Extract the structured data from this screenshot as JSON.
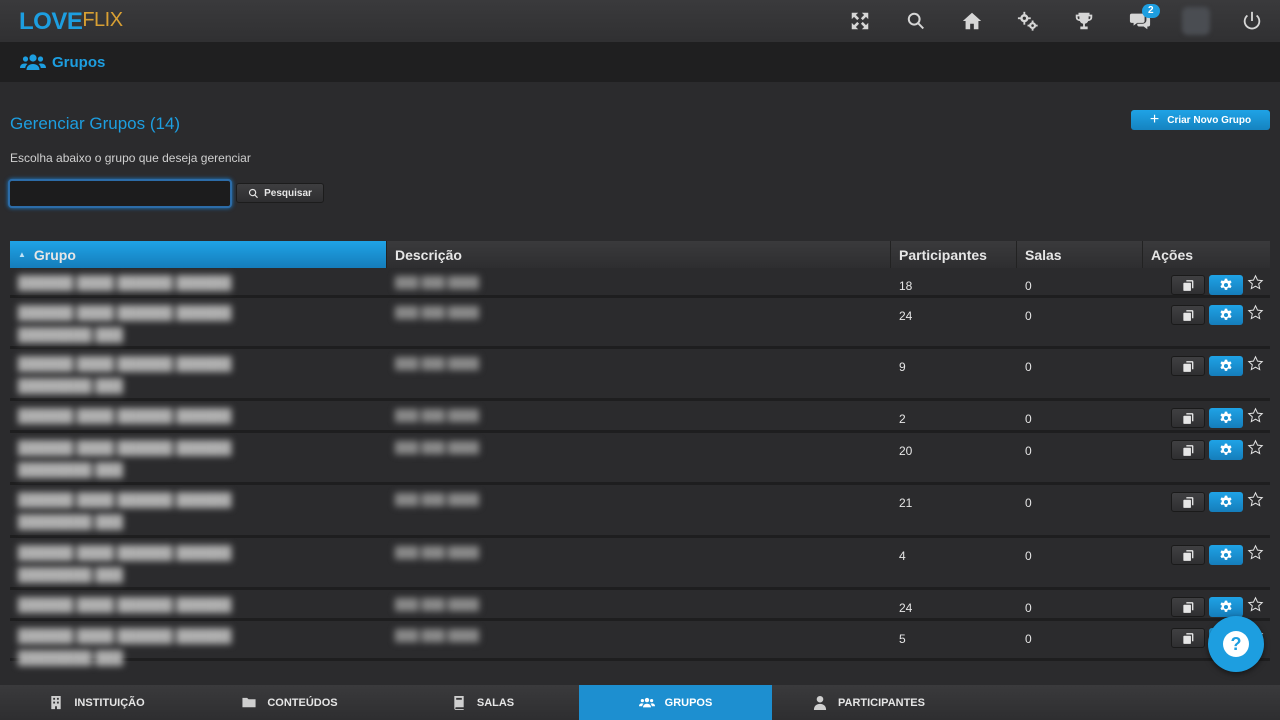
{
  "brand": {
    "love": "LOVE",
    "flix": "FLIX"
  },
  "topbar": {
    "icons": [
      "fullscreen-icon",
      "search-icon",
      "home-icon",
      "settings-gears-icon",
      "trophy-icon",
      "chat-icon",
      "avatar",
      "power-icon"
    ],
    "chat_badge": "2"
  },
  "breadcrumb": {
    "title": "Grupos"
  },
  "main": {
    "heading": "Gerenciar Grupos (14)",
    "subtitle": "Escolha abaixo o grupo que deseja gerenciar",
    "create_button": "Criar Novo Grupo",
    "search_value": "",
    "search_placeholder": "",
    "search_button": "Pesquisar"
  },
  "table": {
    "headers": [
      "Grupo",
      "Descrição",
      "Participantes",
      "Salas",
      "Ações"
    ],
    "rows": [
      {
        "participantes": "18",
        "salas": "0"
      },
      {
        "participantes": "24",
        "salas": "0"
      },
      {
        "participantes": "9",
        "salas": "0"
      },
      {
        "participantes": "2",
        "salas": "0"
      },
      {
        "participantes": "20",
        "salas": "0"
      },
      {
        "participantes": "21",
        "salas": "0"
      },
      {
        "participantes": "4",
        "salas": "0"
      },
      {
        "participantes": "24",
        "salas": "0"
      },
      {
        "participantes": "5",
        "salas": "0"
      }
    ]
  },
  "bottom_nav": [
    {
      "label": "INSTITUIÇÃO",
      "icon": "building-icon"
    },
    {
      "label": "CONTEÚDOS",
      "icon": "folder-icon"
    },
    {
      "label": "SALAS",
      "icon": "book-icon"
    },
    {
      "label": "GRUPOS",
      "icon": "users-icon",
      "active": true
    },
    {
      "label": "PARTICIPANTES",
      "icon": "user-icon"
    }
  ],
  "help": {
    "symbol": "?"
  },
  "colors": {
    "accent": "#1d9ee0",
    "background": "#2b2b2d",
    "logo_flix": "#d9a033"
  }
}
